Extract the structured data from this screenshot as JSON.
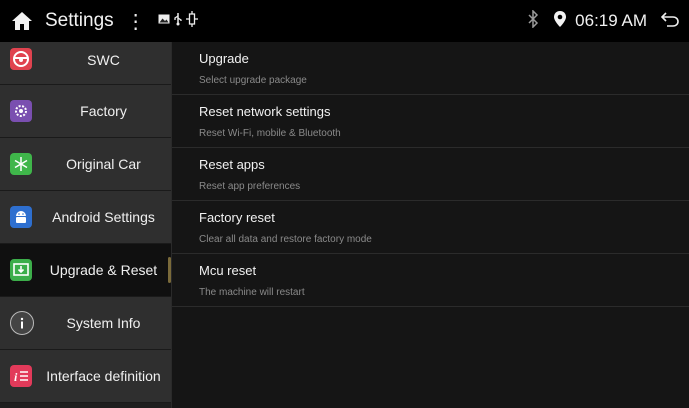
{
  "statusbar": {
    "title": "Settings",
    "more": "⋮",
    "time": "06:19 AM",
    "icons": [
      "home-icon",
      "overflow-menu-icon",
      "gallery-icon",
      "usb-icon",
      "bluetooth-icon",
      "location-pin-icon",
      "back-icon"
    ]
  },
  "sidebar": {
    "items": [
      {
        "label": "SWC",
        "icon": "steering-wheel-icon",
        "color": "#e0434f"
      },
      {
        "label": "Factory",
        "icon": "gear-icon",
        "color": "#7a4fb0"
      },
      {
        "label": "Original Car",
        "icon": "snowflake-icon",
        "color": "#3fb64a"
      },
      {
        "label": "Android Settings",
        "icon": "android-icon",
        "color": "#2e6fcf"
      },
      {
        "label": "Upgrade & Reset",
        "icon": "download-icon",
        "color": "#3cae4a"
      },
      {
        "label": "System Info",
        "icon": "info-icon",
        "color": "#444444"
      },
      {
        "label": "Interface definition",
        "icon": "list-icon",
        "color": "#e23a5a"
      }
    ],
    "active_index": 4
  },
  "content": {
    "rows": [
      {
        "title": "Upgrade",
        "subtitle": "Select upgrade package"
      },
      {
        "title": "Reset network settings",
        "subtitle": "Reset Wi-Fi, mobile & Bluetooth"
      },
      {
        "title": "Reset apps",
        "subtitle": "Reset app preferences"
      },
      {
        "title": "Factory reset",
        "subtitle": "Clear all data and restore factory mode"
      },
      {
        "title": "Mcu reset",
        "subtitle": "The machine will restart"
      }
    ]
  }
}
